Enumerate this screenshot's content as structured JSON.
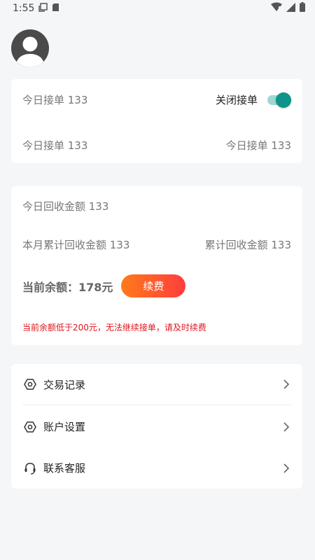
{
  "status_bar": {
    "time": "1:55"
  },
  "orders_card": {
    "today_orders_label": "今日接单 133",
    "toggle_label": "关闭接单",
    "toggle_on": true,
    "row2_left": "今日接单 133",
    "row2_right": "今日接单 133"
  },
  "recycle_card": {
    "today_amount": "今日回收金额 133",
    "month_amount": "本月累计回收金额 133",
    "total_amount": "累计回收金额 133",
    "balance_label": "当前余额：",
    "balance_value": "178元",
    "renew_label": "续费",
    "warning": "当前余额低于200元，无法继续接单，请及时续费"
  },
  "menu": {
    "items": [
      {
        "label": "交易记录"
      },
      {
        "label": "账户设置"
      },
      {
        "label": "联系客服"
      }
    ]
  },
  "colors": {
    "accent_teal": "#0e9488",
    "renew_gradient_start": "#ff7a1a",
    "renew_gradient_end": "#ff3d3d",
    "warning_red": "#e0141e"
  }
}
